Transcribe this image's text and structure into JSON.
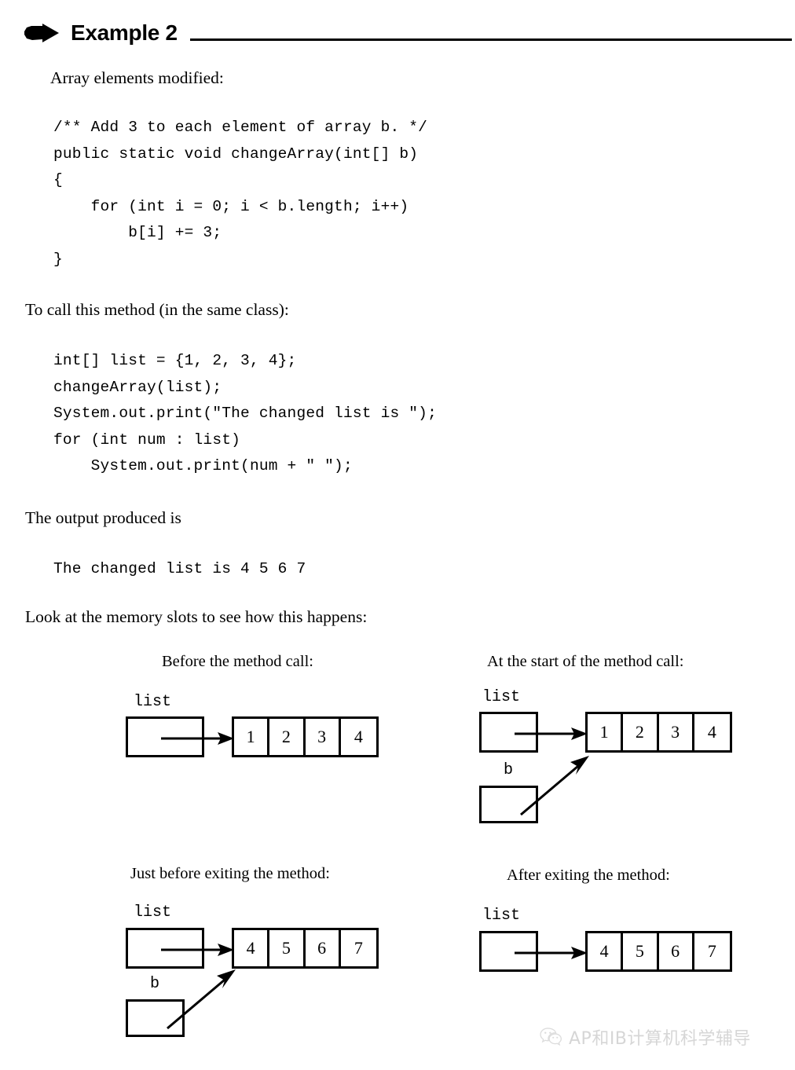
{
  "header": {
    "bullet_icon": "right-arrow-bullet-icon",
    "title": "Example 2"
  },
  "body": {
    "intro": "Array elements modified:",
    "call_intro": "To call this method (in the same class):",
    "output_intro": "The output produced is",
    "memory_intro": "Look at the memory slots to see how this happens:"
  },
  "code_blocks": {
    "method": "/** Add 3 to each element of array b. */\npublic static void changeArray(int[] b)\n{\n    for (int i = 0; i < b.length; i++)\n        b[i] += 3;\n}",
    "caller": "int[] list = {1, 2, 3, 4};\nchangeArray(list);\nSystem.out.print(\"The changed list is \");\nfor (int num : list)\n    System.out.print(num + \" \");",
    "output": "The changed list is 4 5 6 7"
  },
  "diagrams": [
    {
      "caption": "Before the method call:",
      "list_label": "list",
      "b_label": null,
      "array": [
        "1",
        "2",
        "3",
        "4"
      ],
      "has_b_box": false
    },
    {
      "caption": "At the start of the method call:",
      "list_label": "list",
      "b_label": "b",
      "array": [
        "1",
        "2",
        "3",
        "4"
      ],
      "has_b_box": true
    },
    {
      "caption": "Just before exiting the method:",
      "list_label": "list",
      "b_label": "b",
      "array": [
        "4",
        "5",
        "6",
        "7"
      ],
      "has_b_box": true
    },
    {
      "caption": "After exiting the method:",
      "list_label": "list",
      "b_label": null,
      "array": [
        "4",
        "5",
        "6",
        "7"
      ],
      "has_b_box": false
    }
  ],
  "watermark": {
    "icon": "wechat-icon",
    "text": "AP和IB计算机科学辅导"
  },
  "colors": {
    "ink": "#000000",
    "paper": "#ffffff",
    "watermark": "#8a8a8a"
  }
}
